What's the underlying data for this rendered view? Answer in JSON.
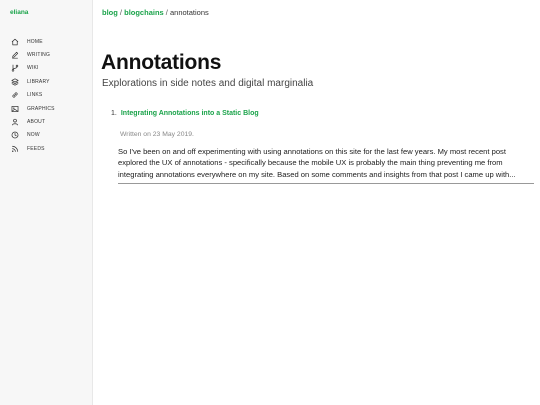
{
  "sidebar": {
    "brand": "eliana",
    "items": [
      {
        "label": "HOME",
        "icon": "home-icon"
      },
      {
        "label": "WRITING",
        "icon": "pencil-icon"
      },
      {
        "label": "WIKI",
        "icon": "branch-icon"
      },
      {
        "label": "LIBRARY",
        "icon": "layers-icon"
      },
      {
        "label": "LINKS",
        "icon": "link-icon"
      },
      {
        "label": "GRAPHICS",
        "icon": "image-icon"
      },
      {
        "label": "ABOUT",
        "icon": "user-icon"
      },
      {
        "label": "NOW",
        "icon": "clock-icon"
      },
      {
        "label": "FEEDS",
        "icon": "rss-icon"
      }
    ]
  },
  "breadcrumb": {
    "items": [
      "blog",
      "blogchains"
    ],
    "separator": "/",
    "current": "annotations"
  },
  "page": {
    "title": "Annotations",
    "subtitle": "Explorations in side notes and digital marginalia"
  },
  "posts": [
    {
      "number": "1.",
      "title": "Integrating Annotations into a Static Blog",
      "date": "Written on 23 May 2019.",
      "excerpt": "So I've been on and off experimenting with using annotations on this site for the last few years. My most recent post explored the UX of annotations - specifically because the mobile UX is probably the main thing preventing me from integrating annotations everywhere on my site. Based on some comments and insights from that post I came up with..."
    }
  ],
  "colors": {
    "accent": "#1aa34a",
    "sidebar_bg": "#f7f7f7",
    "text": "#222222",
    "muted": "#888888"
  }
}
